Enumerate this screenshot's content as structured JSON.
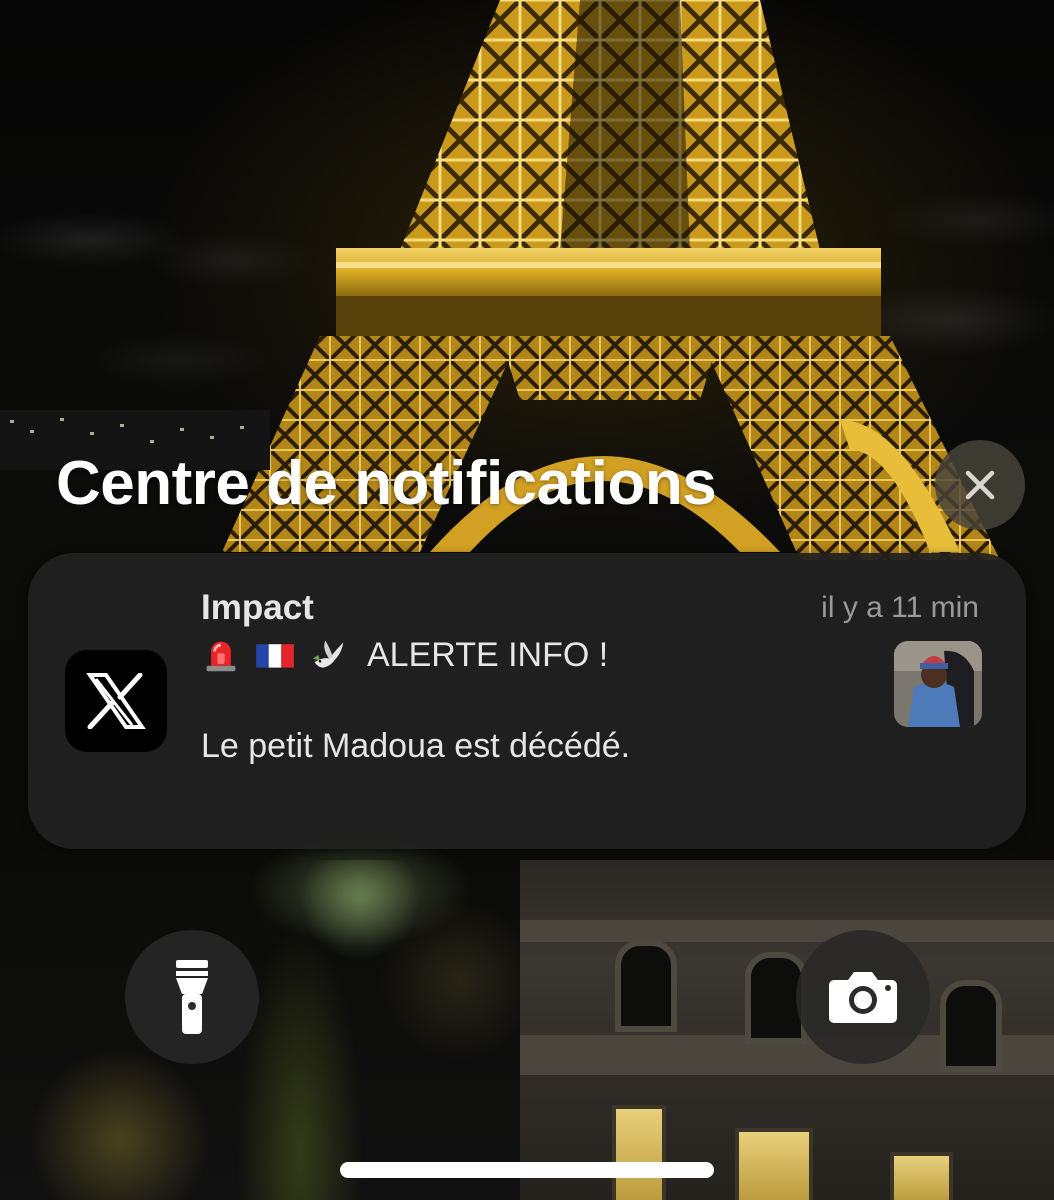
{
  "notification_center": {
    "title": "Centre de notifications",
    "close_icon": "close-icon"
  },
  "notification": {
    "app_icon": "x-logo-icon",
    "app_name": "Impact",
    "time": "il y a 11 min",
    "emojis": [
      "rotating-light-emoji",
      "france-flag-emoji",
      "dove-emoji"
    ],
    "headline": "ALERTE INFO !",
    "body": "Le petit Madoua est décédé."
  },
  "quick_actions": {
    "flashlight_icon": "flashlight-icon",
    "camera_icon": "camera-icon"
  },
  "colors": {
    "card_bg": "#212121",
    "tower_gold": "#e0b52a",
    "secondary_text": "#9a9a9a"
  }
}
